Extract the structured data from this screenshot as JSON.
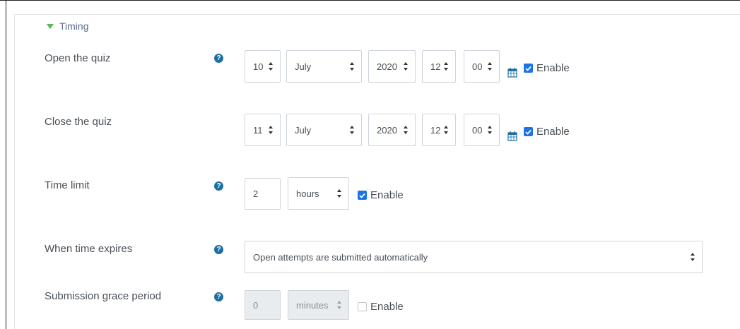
{
  "section": {
    "title": "Timing"
  },
  "enable_label": "Enable",
  "open_quiz": {
    "label": "Open the quiz",
    "day": "10",
    "month": "July",
    "year": "2020",
    "hour": "12",
    "minute": "00",
    "enabled": true
  },
  "close_quiz": {
    "label": "Close the quiz",
    "day": "11",
    "month": "July",
    "year": "2020",
    "hour": "12",
    "minute": "00",
    "enabled": true
  },
  "time_limit": {
    "label": "Time limit",
    "value": "2",
    "unit": "hours",
    "enabled": true
  },
  "when_expires": {
    "label": "When time expires",
    "value": "Open attempts are submitted automatically"
  },
  "grace_period": {
    "label": "Submission grace period",
    "value": "0",
    "unit": "minutes",
    "enabled": false
  },
  "colors": {
    "accent": "#1a73e8",
    "help_icon": "#1e6fa0",
    "section_toggle": "#5bb75b"
  }
}
